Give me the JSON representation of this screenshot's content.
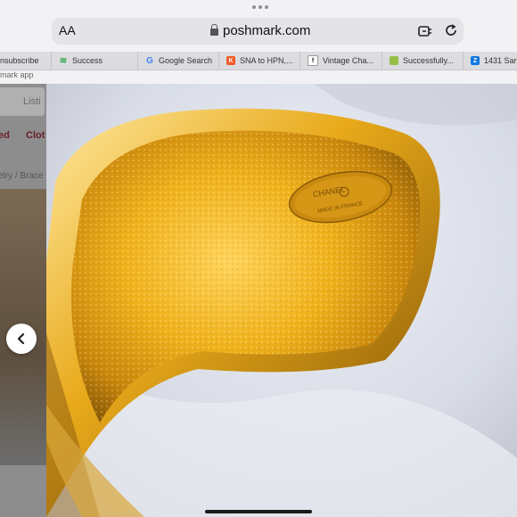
{
  "browser": {
    "text_size_label": "AA",
    "url": "poshmark.com"
  },
  "tabs": [
    {
      "label": "nsubscribe",
      "icon": "none"
    },
    {
      "label": "Success",
      "icon": "wifi-icon",
      "color": "#34a853"
    },
    {
      "label": "Google Search",
      "icon": "google-icon",
      "color": "#4285f4"
    },
    {
      "label": "SNA to HPN,...",
      "icon": "k-icon",
      "color": "#f05a28"
    },
    {
      "label": "Vintage Cha...",
      "icon": "f-icon",
      "color": "#333333"
    },
    {
      "label": "Successfully...",
      "icon": "bag-icon",
      "color": "#95bf47"
    },
    {
      "label": "1431 San",
      "icon": "zillow-icon",
      "color": "#1277e1"
    }
  ],
  "page": {
    "subline": "mark app",
    "search_placeholder": "Listi",
    "nav_left": "ed",
    "nav_right": "Clot",
    "breadcrumb": "elry  /  Brace"
  },
  "photo": {
    "engraving_brand": "CHANEL",
    "engraving_origin": "MADE IN FRANCE"
  }
}
